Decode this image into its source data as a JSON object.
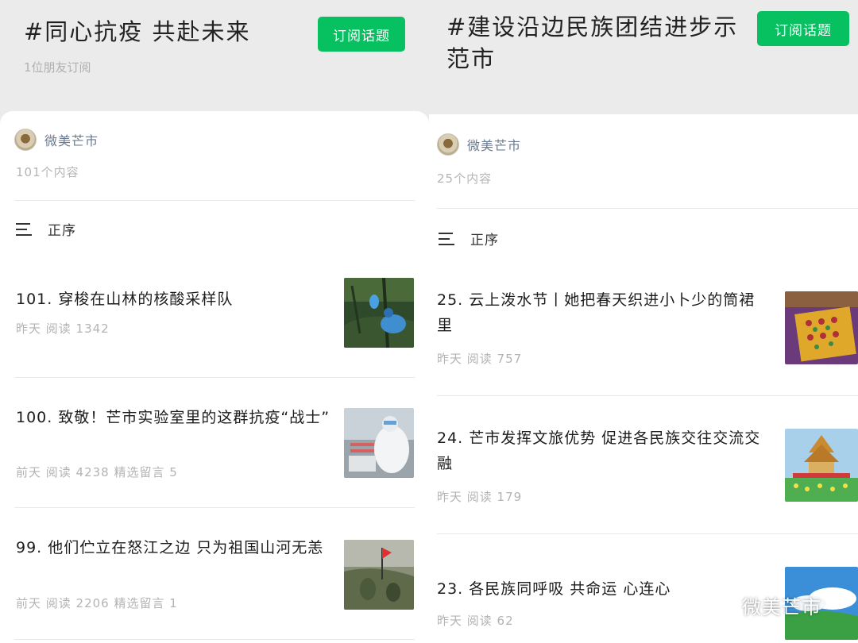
{
  "left": {
    "topic_title": "#同心抗疫 共赴未来",
    "subscribe_label": "订阅话题",
    "subscribers": "1位朋友订阅",
    "account_name": "微美芒市",
    "content_count": "101个内容",
    "sort_label": "正序",
    "articles": [
      {
        "title": "101. 穿梭在山林的核酸采样队",
        "meta": "昨天  阅读 1342",
        "thumb": "forest-sampling-team"
      },
      {
        "title": "100. 致敬！芒市实验室里的这群抗疫“战士”",
        "meta": "前天  阅读 4238  精选留言 5",
        "thumb": "lab-worker"
      },
      {
        "title": "99. 他们伫立在怒江之边 只为祖国山河无恙",
        "meta": "前天  阅读 2206  精选留言 1",
        "thumb": "river-guard"
      }
    ]
  },
  "right": {
    "topic_title": "#建设沿边民族团结进步示范市",
    "subscribe_label": "订阅话题",
    "account_name": "微美芒市",
    "content_count": "25个内容",
    "sort_label": "正序",
    "articles": [
      {
        "title": "25. 云上泼水节丨她把春天织进小卜少的筒裙里",
        "meta": "昨天  阅读 757",
        "thumb": "woven-fabric"
      },
      {
        "title": "24. 芒市发挥文旅优势 促进各民族交往交流交融",
        "meta": "昨天  阅读 179",
        "thumb": "pagoda-festival"
      },
      {
        "title": "23. 各民族同呼吸 共命运 心连心",
        "meta": "昨天  阅读 62",
        "thumb": "grassland-sky"
      }
    ]
  },
  "watermark": "微美芒市",
  "colors": {
    "accent": "#07c160",
    "header_bg": "#ebebeb",
    "account": "#6b7a90",
    "meta": "#b3b3b3"
  }
}
